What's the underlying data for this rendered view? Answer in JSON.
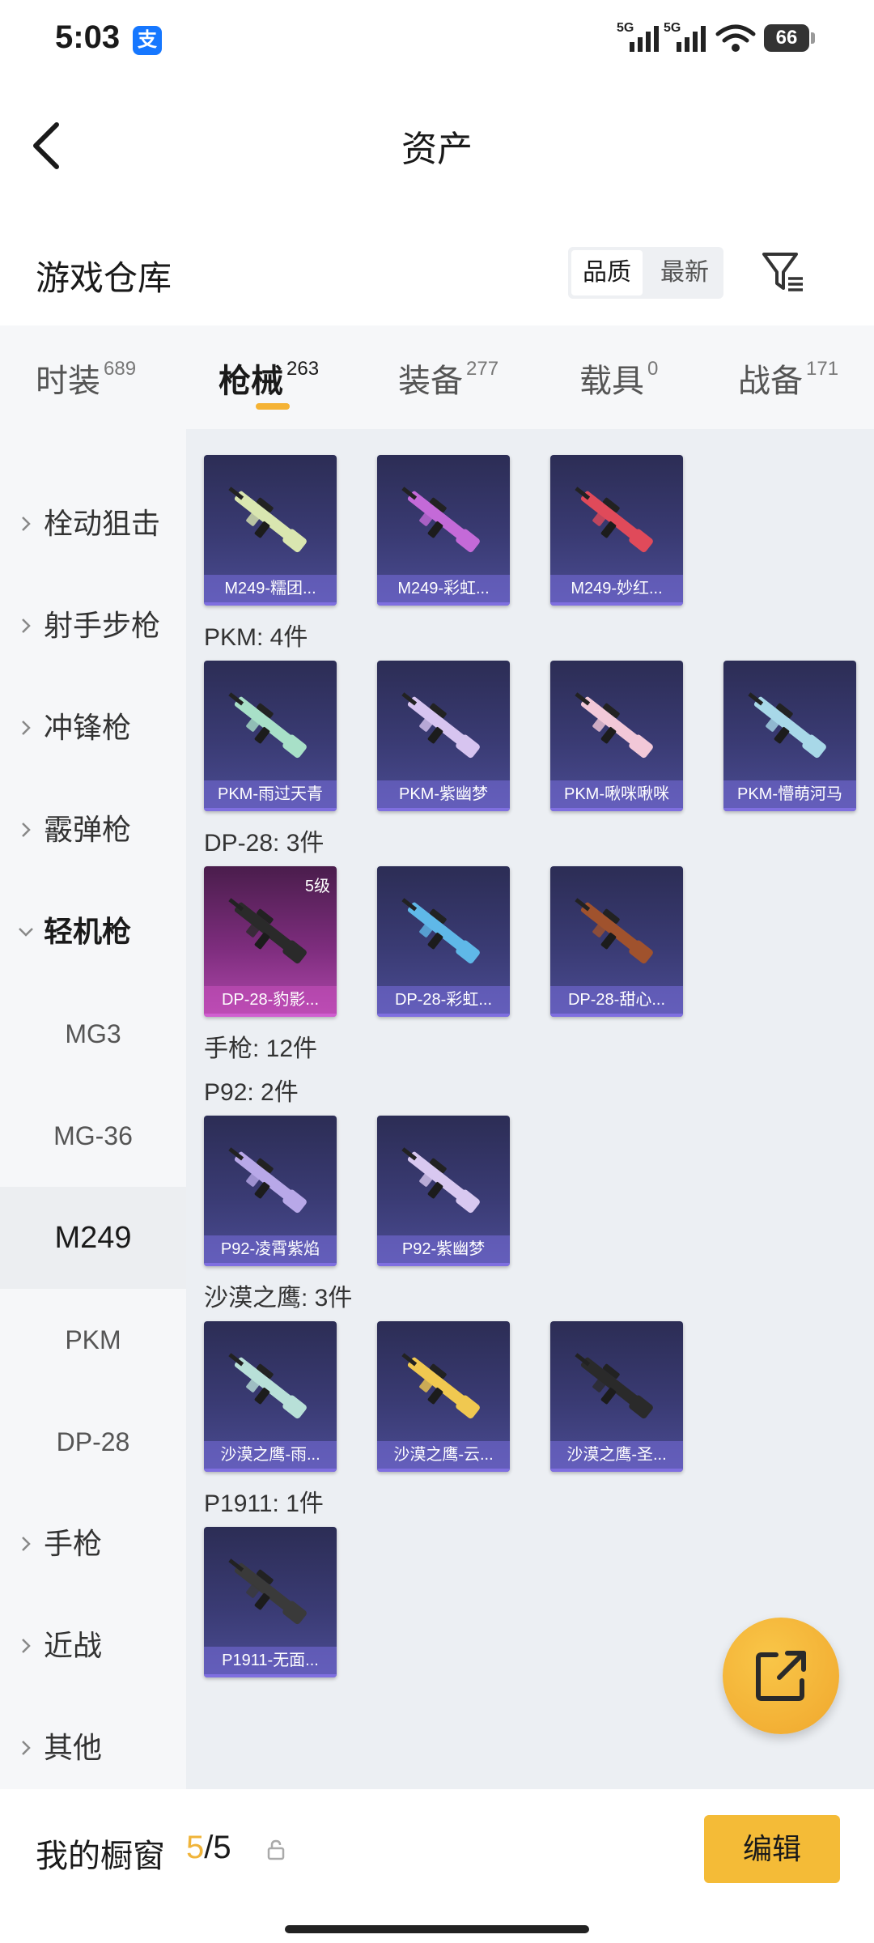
{
  "status_bar": {
    "time": "5:03",
    "alipay_icon": "支",
    "signal_1_label": "5G",
    "signal_2_label": "5G",
    "battery": "66"
  },
  "header": {
    "title": "资产"
  },
  "warehouse": {
    "title": "游戏仓库",
    "sort_options": [
      "品质",
      "最新"
    ],
    "selected_sort": "品质"
  },
  "tabs": [
    {
      "label": "时装",
      "count": "689"
    },
    {
      "label": "枪械",
      "count": "263",
      "active": true
    },
    {
      "label": "装备",
      "count": "277"
    },
    {
      "label": "载具",
      "count": "0"
    },
    {
      "label": "战备",
      "count": "171"
    }
  ],
  "sidebar": {
    "categories": [
      "栓动狙击",
      "射手步枪",
      "冲锋枪",
      "霰弹枪",
      "轻机枪",
      "手枪",
      "近战",
      "其他"
    ],
    "expanded_category": "轻机枪",
    "subcategories": [
      "MG3",
      "MG-36",
      "M249",
      "PKM",
      "DP-28"
    ],
    "active_subcategory": "M249"
  },
  "content": {
    "groups": [
      {
        "label": "",
        "items": [
          {
            "name": "M249-糯团...",
            "color": "#d9e6b0"
          },
          {
            "name": "M249-彩虹...",
            "color": "#c46ad8"
          },
          {
            "name": "M249-妙红...",
            "color": "#e04a5a"
          }
        ]
      },
      {
        "label": "PKM: 4件",
        "items": [
          {
            "name": "PKM-雨过天青",
            "color": "#a8e0c8"
          },
          {
            "name": "PKM-紫幽梦",
            "color": "#d7c4f0"
          },
          {
            "name": "PKM-啾咪啾咪",
            "color": "#f2c8d8"
          },
          {
            "name": "PKM-懵萌河马",
            "color": "#a8d8e8"
          }
        ]
      },
      {
        "label": "DP-28: 3件",
        "items": [
          {
            "name": "DP-28-豹影...",
            "color": "#2a2a2a",
            "level": "5级",
            "pink": true
          },
          {
            "name": "DP-28-彩虹...",
            "color": "#5fb8e8"
          },
          {
            "name": "DP-28-甜心...",
            "color": "#a0522d"
          }
        ]
      },
      {
        "label": "手枪: 12件",
        "items": []
      },
      {
        "label": "P92: 2件",
        "items": [
          {
            "name": "P92-凌霄紫焰",
            "color": "#b8a8e8"
          },
          {
            "name": "P92-紫幽梦",
            "color": "#d8c8f0"
          }
        ]
      },
      {
        "label": "沙漠之鹰: 3件",
        "items": [
          {
            "name": "沙漠之鹰-雨...",
            "color": "#b8e0d8"
          },
          {
            "name": "沙漠之鹰-云...",
            "color": "#f0c850"
          },
          {
            "name": "沙漠之鹰-圣...",
            "color": "#2a2a2a"
          }
        ]
      },
      {
        "label": "P1911: 1件",
        "items": [
          {
            "name": "P1911-无面...",
            "color": "#3a3a3a"
          }
        ]
      }
    ]
  },
  "bottom_bar": {
    "showcase_label": "我的橱窗",
    "showcase_current": "5",
    "showcase_total": "/5",
    "edit_label": "编辑"
  },
  "colors": {
    "accent": "#f4bb37",
    "card_bg": "#3a3b74",
    "card_pink_bg": "#7e2d7e"
  }
}
